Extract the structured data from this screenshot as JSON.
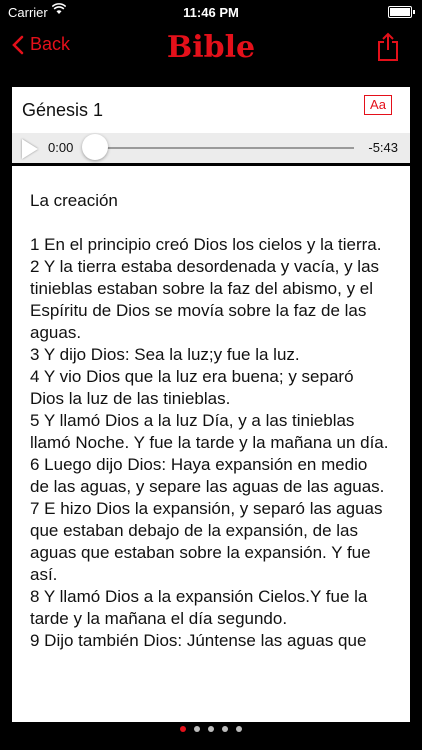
{
  "status_bar": {
    "carrier": "Carrier",
    "time": "11:46 PM",
    "wifi_icon": "wifi-icon",
    "battery_icon": "battery-icon"
  },
  "nav": {
    "back_label": "Back",
    "title": "Bible",
    "accent": "#e4101a"
  },
  "chapter": {
    "title": "Génesis 1",
    "font_button": "Aa"
  },
  "player": {
    "current": "0:00",
    "remaining": "-5:43",
    "progress": 0.0
  },
  "content": {
    "heading": "La creación",
    "verses": [
      "1 En el principio creó Dios los cielos y la tierra.",
      "2 Y la tierra estaba desordenada y vacía, y las tinieblas estaban sobre la faz del abismo, y el Espíritu de Dios se movía sobre la faz de las aguas.",
      "3 Y dijo Dios: Sea la luz;y fue la luz.",
      "4 Y vio Dios que la luz era buena; y separó Dios la luz de las tinieblas.",
      "5 Y llamó Dios a la luz Día, y a las tinieblas llamó Noche. Y fue la tarde y la mañana un día.",
      "6 Luego dijo Dios: Haya expansión en medio de las aguas, y separe las aguas de las aguas.",
      "7 E hizo Dios la expansión, y separó las aguas que estaban debajo de la expansión, de las aguas que estaban sobre la expansión. Y fue así.",
      "8 Y llamó Dios a la expansión Cielos.Y fue la tarde y la mañana el día segundo.",
      "9 Dijo también Dios: Júntense las aguas que"
    ]
  },
  "pager": {
    "count": 5,
    "active": 0
  }
}
